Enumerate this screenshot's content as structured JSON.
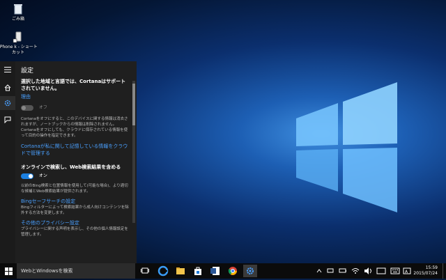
{
  "desktop": {
    "icons": [
      {
        "label": "ごみ箱"
      },
      {
        "label": "iPhone k - ショートカット"
      }
    ]
  },
  "settings": {
    "title": "設定",
    "unsupported_msg": "選択した地域と言語では、Cortanaはサポートされていません。",
    "reason_link": "理由",
    "cortana_toggle_label": "オフ",
    "cortana_desc": "Cortanaをオフにすると、このデバイスに関する情報は消去されますが、ノートブックからの情報は削除されません。Cortanaをオフにしても、クラウドに保存されている情報を使って目的の操作を指定できます。",
    "cloud_link": "Cortanaが私に関して記憶している情報をクラウドで管理する",
    "online_search_heading": "オンラインで検索し、Web検索結果を含める",
    "online_search_toggle_label": "オン",
    "bing_desc": "以前のBing検索と位置情報を使用して(可能な場合)、より適切な候補とWeb検索結果が提供されます。",
    "bing_safe_link": "Bingセーフサーチの設定",
    "bing_safe_desc": "Bingフィルターによって検索結果から成人向けコンテンツを除外する方法を変更します。",
    "privacy_link": "その他のプライバシー設定",
    "privacy_desc": "プライバシーに関する声明を表示し、その他の個人情報設定を管理します。"
  },
  "taskbar": {
    "search_placeholder": "WebとWindowsを検索",
    "time": "15:59",
    "date": "2015/07/24",
    "colors": {
      "accent": "#1b7fe0",
      "bg": "#0b0b0b"
    }
  }
}
